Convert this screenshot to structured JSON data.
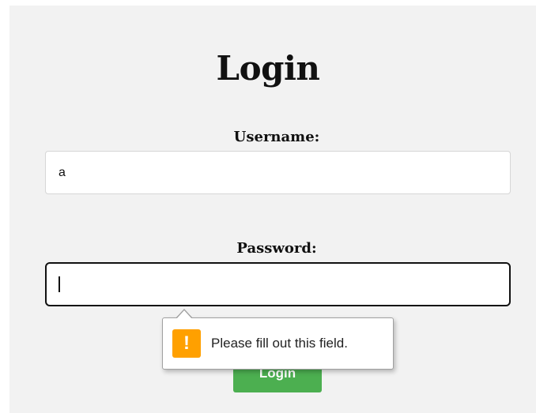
{
  "form": {
    "title": "Login",
    "username_label": "Username:",
    "username_value": "a",
    "password_label": "Password:",
    "password_value": "",
    "login_button_label": "Login"
  },
  "validation_tooltip": {
    "icon": "warning-icon",
    "icon_glyph": "!",
    "icon_color": "#ffa000",
    "message": "Please fill out this field."
  },
  "colors": {
    "card_background": "#f2f2f2",
    "button_background": "#4caf50"
  }
}
